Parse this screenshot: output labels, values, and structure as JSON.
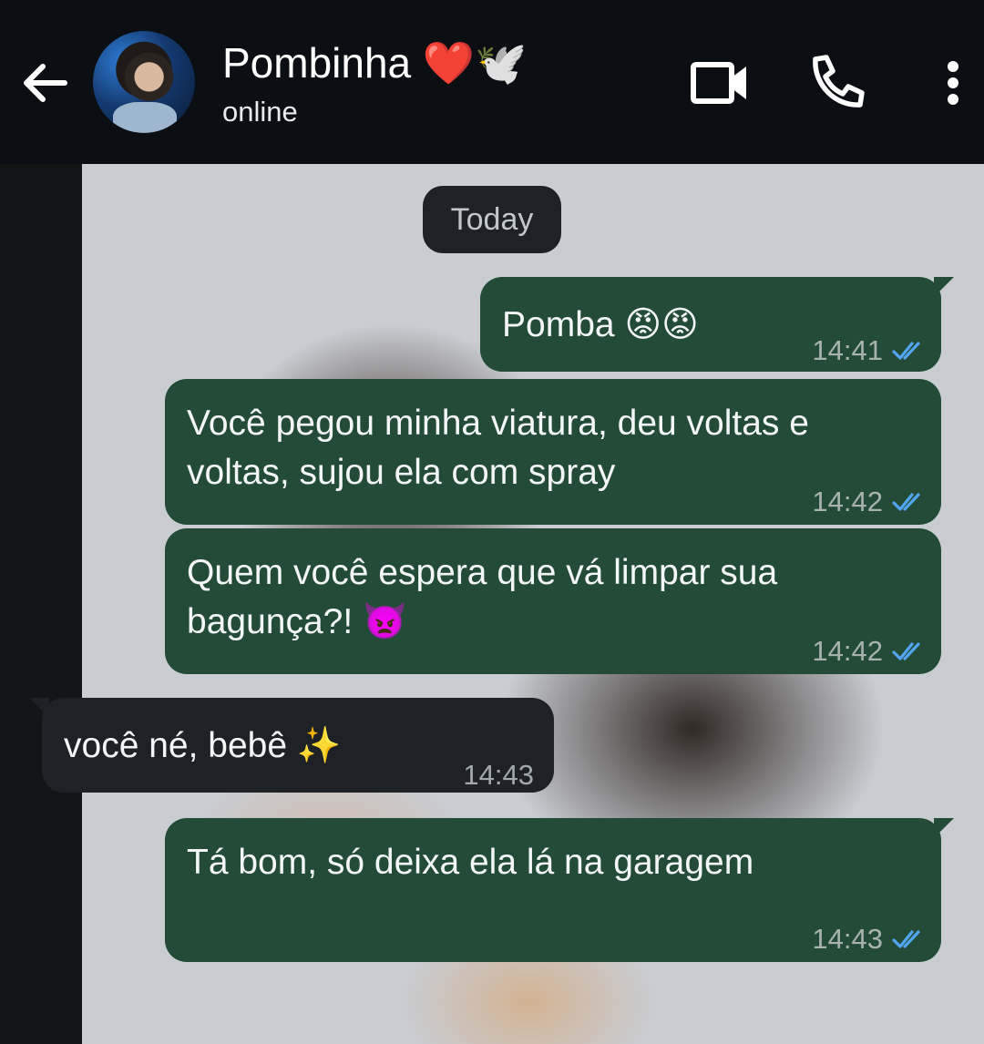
{
  "header": {
    "contact_name": "Pombinha ❤️🕊️",
    "status": "online",
    "icons": [
      "back-arrow-icon",
      "video-call-icon",
      "phone-call-icon",
      "more-options-icon"
    ]
  },
  "chat": {
    "date_label": "Today",
    "messages": [
      {
        "direction": "outgoing",
        "text": "Pomba 😡😡",
        "time": "14:41",
        "read": true
      },
      {
        "direction": "outgoing",
        "line1": "Você pegou minha viatura, deu voltas e",
        "line2": "voltas, sujou ela com spray",
        "time": "14:42",
        "read": true
      },
      {
        "direction": "outgoing",
        "line1": "Quem você espera que vá limpar sua",
        "line2": "bagunça?! 👿",
        "time": "14:42",
        "read": true
      },
      {
        "direction": "incoming",
        "text": "você né, bebê ✨",
        "time": "14:43"
      },
      {
        "direction": "outgoing",
        "text": "Tá bom, só deixa ela lá na garagem",
        "time": "14:43",
        "read": true
      }
    ]
  },
  "colors": {
    "header_bg": "#0b0e12",
    "outgoing_bubble": "#234b37",
    "incoming_bubble": "#1e2226",
    "read_tick": "#53a6f5"
  }
}
